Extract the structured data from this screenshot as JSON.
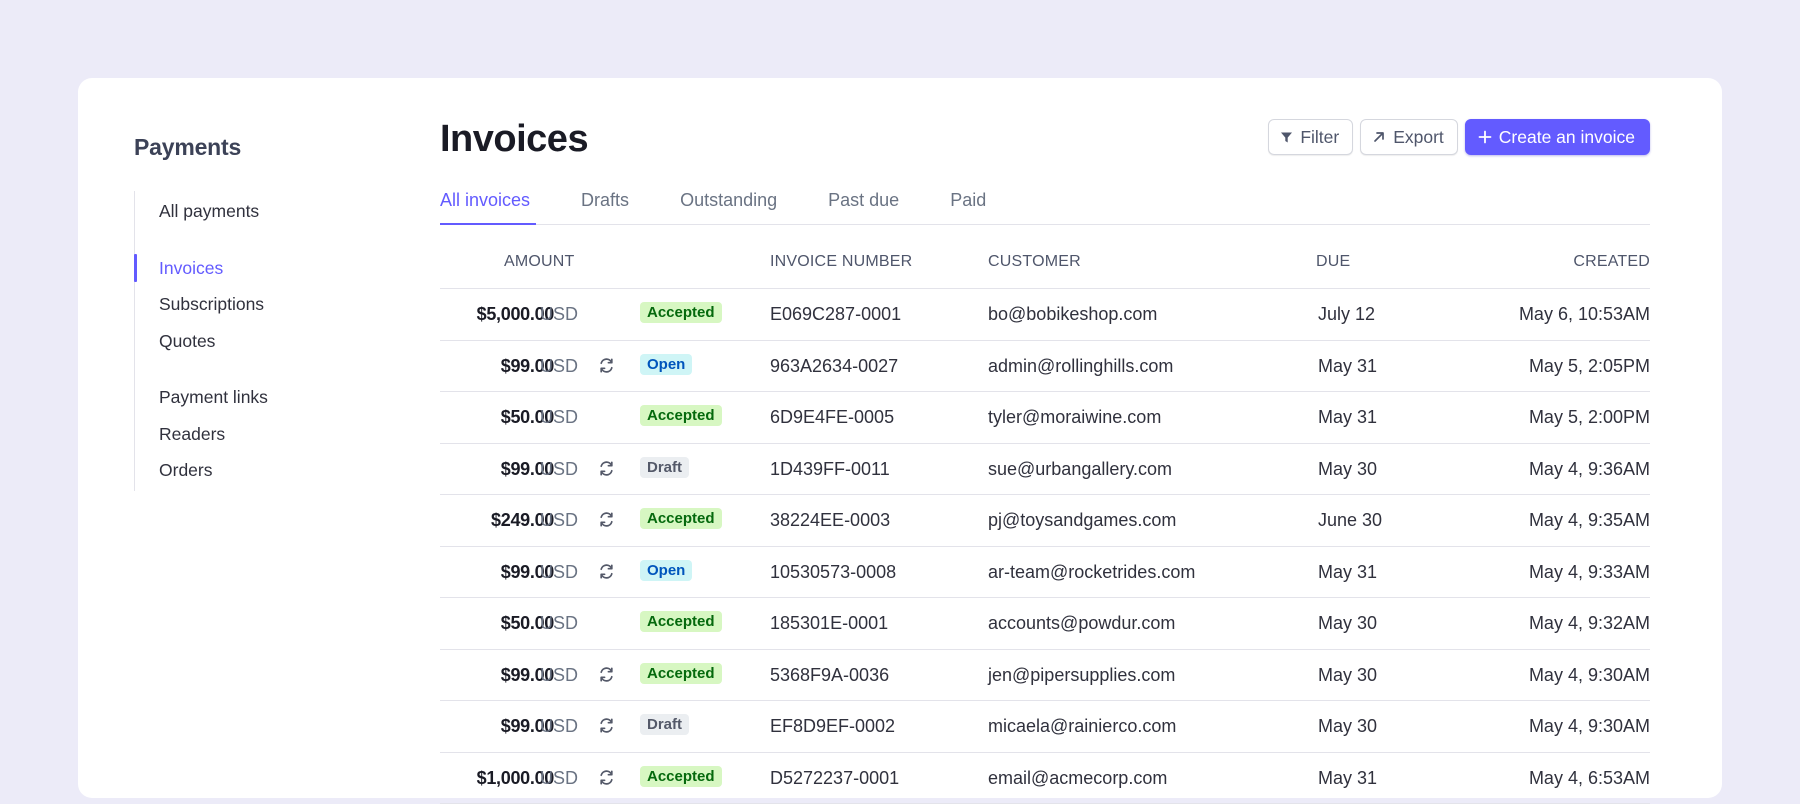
{
  "sidebar": {
    "title": "Payments",
    "items": [
      {
        "label": "All payments"
      },
      {
        "label": "Invoices"
      },
      {
        "label": "Subscriptions"
      },
      {
        "label": "Quotes"
      },
      {
        "label": "Payment links"
      },
      {
        "label": "Readers"
      },
      {
        "label": "Orders"
      }
    ],
    "active_item": "Invoices"
  },
  "header": {
    "title": "Invoices",
    "filter_label": "Filter",
    "export_label": "Export",
    "create_label": "Create an invoice"
  },
  "tabs": [
    {
      "label": "All invoices"
    },
    {
      "label": "Drafts"
    },
    {
      "label": "Outstanding"
    },
    {
      "label": "Past due"
    },
    {
      "label": "Paid"
    }
  ],
  "active_tab": "All invoices",
  "table": {
    "columns": {
      "amount": "AMOUNT",
      "invoice_number": "INVOICE NUMBER",
      "customer": "CUSTOMER",
      "due": "DUE",
      "created": "CREATED"
    },
    "rows": [
      {
        "amount": "$5,000.00",
        "currency": "USD",
        "recurring": false,
        "status": "Accepted",
        "invoice": "E069C287-0001",
        "customer": "bo@bobikeshop.com",
        "due": "July 12",
        "created": "May 6, 10:53AM"
      },
      {
        "amount": "$99.00",
        "currency": "USD",
        "recurring": true,
        "status": "Open",
        "invoice": "963A2634-0027",
        "customer": "admin@rollinghills.com",
        "due": "May 31",
        "created": "May 5, 2:05PM"
      },
      {
        "amount": "$50.00",
        "currency": "USD",
        "recurring": false,
        "status": "Accepted",
        "invoice": "6D9E4FE-0005",
        "customer": "tyler@moraiwine.com",
        "due": "May 31",
        "created": "May 5, 2:00PM"
      },
      {
        "amount": "$99.00",
        "currency": "USD",
        "recurring": true,
        "status": "Draft",
        "invoice": "1D439FF-0011",
        "customer": "sue@urbangallery.com",
        "due": "May 30",
        "created": "May 4, 9:36AM"
      },
      {
        "amount": "$249.00",
        "currency": "USD",
        "recurring": true,
        "status": "Accepted",
        "invoice": "38224EE-0003",
        "customer": "pj@toysandgames.com",
        "due": "June 30",
        "created": "May 4, 9:35AM"
      },
      {
        "amount": "$99.00",
        "currency": "USD",
        "recurring": true,
        "status": "Open",
        "invoice": "10530573-0008",
        "customer": "ar-team@rocketrides.com",
        "due": "May 31",
        "created": "May 4, 9:33AM"
      },
      {
        "amount": "$50.00",
        "currency": "USD",
        "recurring": false,
        "status": "Accepted",
        "invoice": "185301E-0001",
        "customer": "accounts@powdur.com",
        "due": "May 30",
        "created": "May 4, 9:32AM"
      },
      {
        "amount": "$99.00",
        "currency": "USD",
        "recurring": true,
        "status": "Accepted",
        "invoice": "5368F9A-0036",
        "customer": "jen@pipersupplies.com",
        "due": "May 30",
        "created": "May 4, 9:30AM"
      },
      {
        "amount": "$99.00",
        "currency": "USD",
        "recurring": true,
        "status": "Draft",
        "invoice": "EF8D9EF-0002",
        "customer": "micaela@rainierco.com",
        "due": "May 30",
        "created": "May 4, 9:30AM"
      },
      {
        "amount": "$1,000.00",
        "currency": "USD",
        "recurring": true,
        "status": "Accepted",
        "invoice": "D5272237-0001",
        "customer": "email@acmecorp.com",
        "due": "May 31",
        "created": "May 4, 6:53AM"
      }
    ]
  },
  "colors": {
    "background": "#ecebf8",
    "accent": "#635bff",
    "accepted_bg": "#d7f7c2",
    "open_bg": "#cff5f6",
    "draft_bg": "#ebeef1"
  },
  "icons": {
    "filter": "filter-icon",
    "export": "arrow-up-right-icon",
    "create": "plus-icon",
    "recurring": "recurring-icon"
  }
}
